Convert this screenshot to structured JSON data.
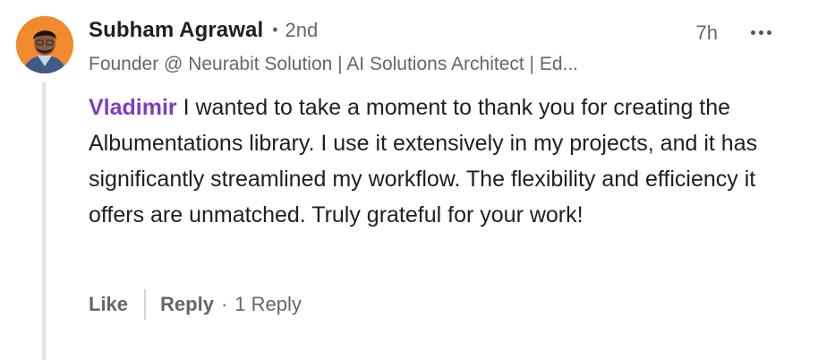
{
  "comment": {
    "author_name": "Subham Agrawal",
    "connection_degree": "2nd",
    "dot": "•",
    "timestamp": "7h",
    "headline": "Founder @ Neurabit Solution | AI Solutions Architect | Ed...",
    "mention": "Vladimir",
    "text": " I wanted to take a moment to thank you for creating the Albumentations library. I use it extensively in my projects, and it has significantly streamlined my workflow. The flexibility and efficiency it offers are unmatched. Truly grateful for your work!",
    "more_icon": "ellipsis-horizontal-icon",
    "avatar_bg": "#f08a2c",
    "mention_color": "#7a3fc1"
  },
  "actions": {
    "like_label": "Like",
    "reply_label": "Reply",
    "middot": "·",
    "reply_count": "1 Reply"
  }
}
